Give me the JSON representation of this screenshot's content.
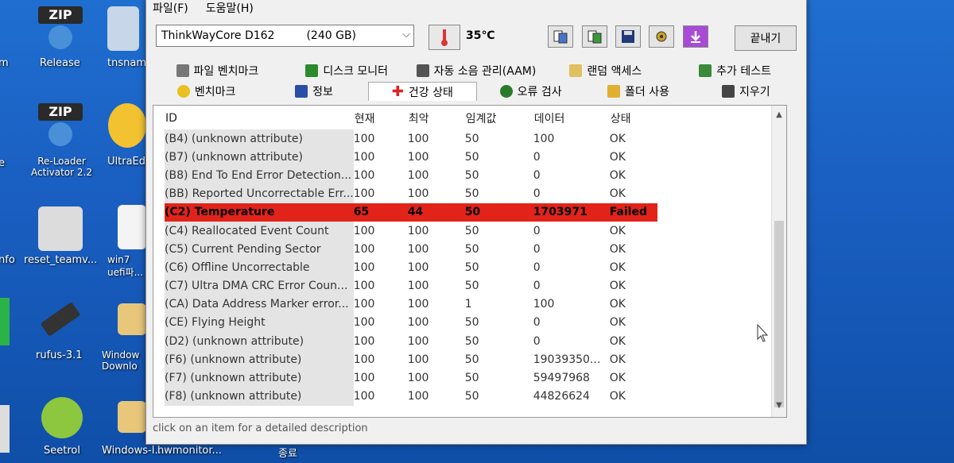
{
  "desktop": {
    "icons": [
      {
        "label": "Release",
        "badge": "ZIP"
      },
      {
        "label": "tnsnam"
      },
      {
        "label": "Re-Loader Activator 2.2",
        "badge": "ZIP"
      },
      {
        "label": "UltraEdi"
      },
      {
        "label": "reset_teamv..."
      },
      {
        "label": "win7 uefi파..."
      },
      {
        "label": "rufus-3.1"
      },
      {
        "label": "Window Downlo"
      },
      {
        "label": "Seetrol"
      },
      {
        "label": "Windows-I..."
      },
      {
        "label": "hwmonitor..."
      },
      {
        "label": "종료"
      }
    ],
    "left_edge": [
      "m",
      "e",
      "nfo"
    ]
  },
  "menu": [
    "파일(F)",
    "도움말(H)"
  ],
  "toolbar": {
    "drive": "ThinkWayCore D162",
    "capacity": "(240 GB)",
    "temperature": "35℃",
    "exit_label": "끝내기"
  },
  "tabs_row1": [
    "파일 벤치마크",
    "디스크 모니터",
    "자동 소음 관리(AAM)",
    "랜덤 액세스",
    "추가 테스트"
  ],
  "tabs_row2": [
    "벤치마크",
    "정보",
    "건강 상태",
    "오류 검사",
    "폴더 사용",
    "지우기"
  ],
  "table": {
    "headers": [
      "ID",
      "현재",
      "최악",
      "임계값",
      "데이터",
      "상태"
    ],
    "rows": [
      [
        "(B4) (unknown attribute)",
        "100",
        "100",
        "50",
        "100",
        "OK"
      ],
      [
        "(B7) (unknown attribute)",
        "100",
        "100",
        "50",
        "0",
        "OK"
      ],
      [
        "(B8) End To End Error Detection...",
        "100",
        "100",
        "50",
        "0",
        "OK"
      ],
      [
        "(BB) Reported Uncorrectable Err...",
        "100",
        "100",
        "50",
        "0",
        "OK"
      ],
      [
        "(C2) Temperature",
        "65",
        "44",
        "50",
        "1703971",
        "Failed"
      ],
      [
        "(C4) Reallocated Event Count",
        "100",
        "100",
        "50",
        "0",
        "OK"
      ],
      [
        "(C5) Current Pending Sector",
        "100",
        "100",
        "50",
        "0",
        "OK"
      ],
      [
        "(C6) Offline Uncorrectable",
        "100",
        "100",
        "50",
        "0",
        "OK"
      ],
      [
        "(C7) Ultra DMA CRC Error Coun...",
        "100",
        "100",
        "50",
        "0",
        "OK"
      ],
      [
        "(CA) Data Address Marker error...",
        "100",
        "100",
        "1",
        "100",
        "OK"
      ],
      [
        "(CE) Flying Height",
        "100",
        "100",
        "50",
        "0",
        "OK"
      ],
      [
        "(D2) (unknown attribute)",
        "100",
        "100",
        "50",
        "0",
        "OK"
      ],
      [
        "(F6) (unknown attribute)",
        "100",
        "100",
        "50",
        "19039350...",
        "OK"
      ],
      [
        "(F7) (unknown attribute)",
        "100",
        "100",
        "50",
        "59497968",
        "OK"
      ],
      [
        "(F8) (unknown attribute)",
        "100",
        "100",
        "50",
        "44826624",
        "OK"
      ]
    ]
  },
  "statusbar": "click on an item for a detailed description",
  "colors": {
    "failed_row": "#e2231a",
    "desktop": "#1a5fc2"
  }
}
